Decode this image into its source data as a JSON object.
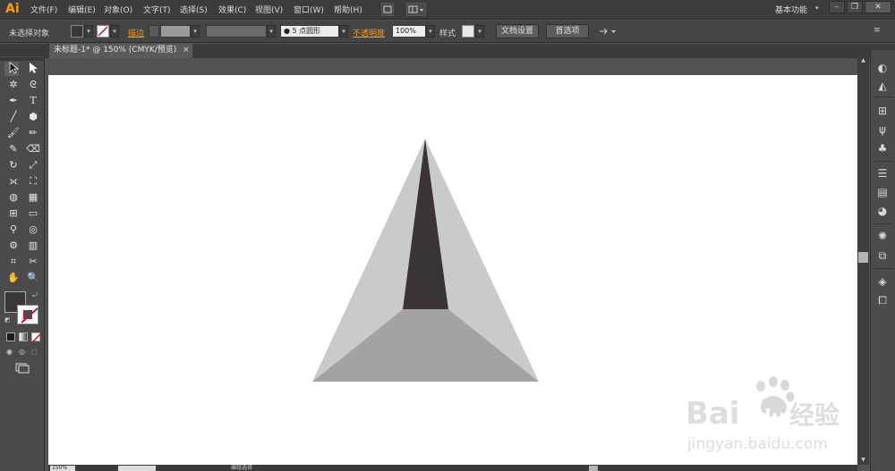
{
  "app": {
    "logo": "Ai"
  },
  "menu": {
    "items": [
      "文件(F)",
      "编辑(E)",
      "对象(O)",
      "文字(T)",
      "选择(S)",
      "效果(C)",
      "视图(V)",
      "窗口(W)",
      "帮助(H)"
    ],
    "workspace": "基本功能"
  },
  "window_controls": {
    "minimize": "–",
    "restore": "❐",
    "close": "✕"
  },
  "controlbar": {
    "selection": "未选择对象",
    "stroke_label": "描边",
    "brush_value": "5 点圆形",
    "opacity_label": "不透明度",
    "opacity_value": "100%",
    "style_label": "样式",
    "doc_setup_button": "文档设置",
    "prefs_button": "首选项"
  },
  "document": {
    "tab_title": "未标题-1* @ 150% (CMYK/预览)",
    "tab_close": "×"
  },
  "status": {
    "zoom": "150%",
    "text": "编组选择"
  },
  "artwork": {
    "left_face_color": "#c9cbca",
    "right_face_color": "#c9cbca",
    "bottom_face_color": "#a2a3a2",
    "center_face_color": "#3a3434"
  },
  "watermark": {
    "brand": "Bai",
    "brand2": "du",
    "cn": "经验",
    "url": "jingyan.baidu.com"
  },
  "colors": {
    "accent": "#ff9a00",
    "fill": "#3a3636",
    "stroke_none": "#c8102e"
  }
}
